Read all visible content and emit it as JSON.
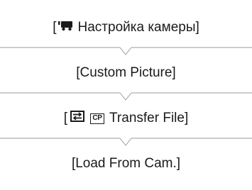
{
  "menu_path": {
    "step1": {
      "bracket_open": "[",
      "icon": "camera-icon",
      "label": "Настройка камеры",
      "bracket_close": "]"
    },
    "step2": {
      "label": "[Custom Picture]"
    },
    "step3": {
      "bracket_open": "[",
      "icon_transfer": "transfer-icon",
      "icon_cp": "CP",
      "label": "Transfer File",
      "bracket_close": "]"
    },
    "step4": {
      "label": "[Load From Cam.]"
    }
  }
}
